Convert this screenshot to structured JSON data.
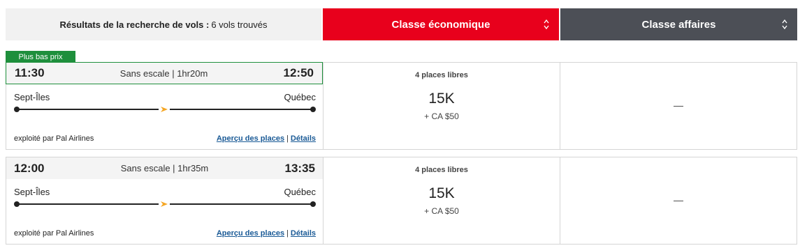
{
  "summary": {
    "label": "Résultats de la recherche de vols :",
    "count_text": "6 vols trouvés"
  },
  "cabins": [
    {
      "label": "Classe économique",
      "color": "#e8001c",
      "sort_icon": "sort-updown-icon"
    },
    {
      "label": "Classe affaires",
      "color": "#4c4f56",
      "sort_icon": "sort-updown-icon"
    }
  ],
  "badge": {
    "label": "Plus bas prix",
    "color": "#1e8f3c"
  },
  "flights": [
    {
      "depart_time": "11:30",
      "duration": "Sans escale | 1hr20m",
      "arrive_time": "12:50",
      "origin": "Sept-Îles",
      "destination": "Québec",
      "operator": "exploité par Pal Airlines",
      "seat_preview_link": "Aperçu des places",
      "details_link": "Détails",
      "economy": {
        "seats": "4 places libres",
        "points": "15K",
        "taxes": "+ CA $50"
      },
      "business": {
        "value": "—"
      }
    },
    {
      "depart_time": "12:00",
      "duration": "Sans escale | 1hr35m",
      "arrive_time": "13:35",
      "origin": "Sept-Îles",
      "destination": "Québec",
      "operator": "exploité par Pal Airlines",
      "seat_preview_link": "Aperçu des places",
      "details_link": "Détails",
      "economy": {
        "seats": "4 places libres",
        "points": "15K",
        "taxes": "+ CA $50"
      },
      "business": {
        "value": "—"
      }
    }
  ],
  "link_separator": "|",
  "icons": {
    "route_plane": "plane-icon",
    "accent": "#f5a623"
  }
}
